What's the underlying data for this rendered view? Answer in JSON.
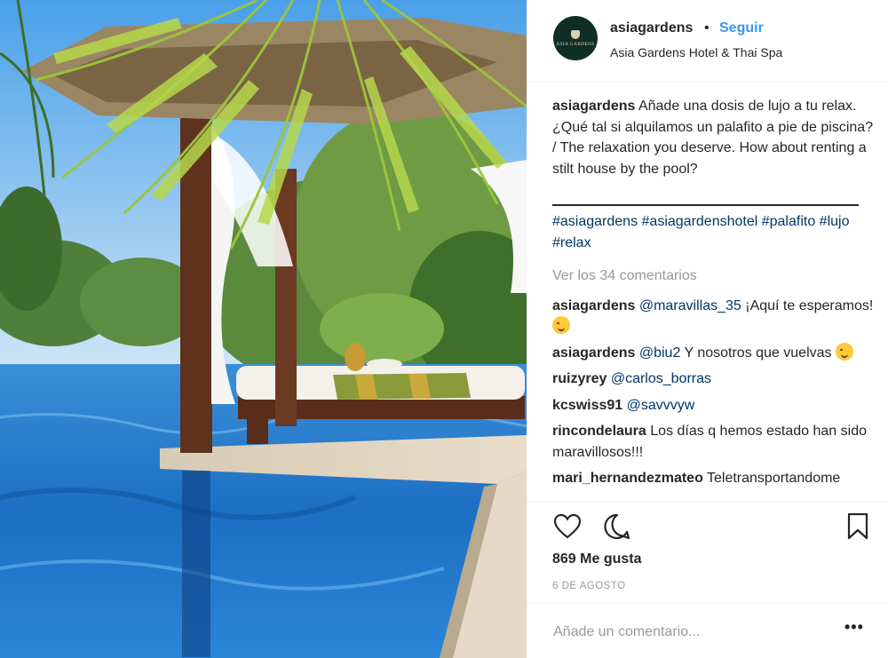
{
  "post": {
    "image_alt": "Cabana by the pool under palm trees"
  },
  "header": {
    "avatar_text": "ASIA GARDENS",
    "username": "asiagardens",
    "separator": "•",
    "follow_label": "Seguir",
    "location": "Asia Gardens Hotel & Thai Spa"
  },
  "caption": {
    "username": "asiagardens",
    "text": "Añade una dosis de lujo a tu relax. ¿Qué tal si alquilamos un palafito a pie de piscina? / The relaxation you deserve. How about renting a stilt house by the pool?",
    "hashtags": "#asiagardens #asiagardenshotel #palafito #lujo #relax"
  },
  "view_more": "Ver los 34 comentarios",
  "comments": [
    {
      "user": "asiagardens",
      "mention": "@maravillas_35",
      "text": " ¡Aquí te esperamos!",
      "emoji": "wink-face-emoji"
    },
    {
      "user": "asiagardens",
      "mention": "@biu2",
      "text": " Y nosotros que vuelvas",
      "emoji": "hugging-face-emoji"
    },
    {
      "user": "ruizyrey",
      "mention": "@carlos_borras",
      "text": ""
    },
    {
      "user": "kcswiss91",
      "mention": "@savvvyw",
      "text": ""
    },
    {
      "user": "rincondelaura",
      "mention": "",
      "text": "Los días q hemos estado han sido maravillosos!!!"
    },
    {
      "user": "mari_hernandezmateo",
      "mention": "",
      "text": "Teletransportandome"
    }
  ],
  "likes": "869 Me gusta",
  "date": "6 DE AGOSTO",
  "add_comment_placeholder": "Añade un comentario...",
  "more_options": "•••",
  "colors": {
    "link": "#3897f0",
    "mention": "#003569",
    "muted": "#999999",
    "avatar_bg": "#0f2e26"
  }
}
